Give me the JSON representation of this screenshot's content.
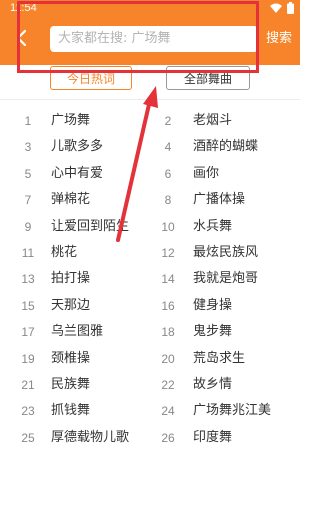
{
  "status_bar": {
    "time": "11:54"
  },
  "header": {
    "search_placeholder": "大家都在搜: 广场舞",
    "search_button": "搜索"
  },
  "tabs": [
    {
      "label": "今日热词",
      "active": true
    },
    {
      "label": "全部舞曲",
      "active": false
    }
  ],
  "list": [
    {
      "left": {
        "rank": "1",
        "name": "广场舞"
      },
      "right": {
        "rank": "2",
        "name": "老烟斗"
      }
    },
    {
      "left": {
        "rank": "3",
        "name": "儿歌多多"
      },
      "right": {
        "rank": "4",
        "name": "酒醉的蝴蝶"
      }
    },
    {
      "left": {
        "rank": "5",
        "name": "心中有爱"
      },
      "right": {
        "rank": "6",
        "name": "画你"
      }
    },
    {
      "left": {
        "rank": "7",
        "name": "弹棉花"
      },
      "right": {
        "rank": "8",
        "name": "广播体操"
      }
    },
    {
      "left": {
        "rank": "9",
        "name": "让爱回到陌生"
      },
      "right": {
        "rank": "10",
        "name": "水兵舞"
      }
    },
    {
      "left": {
        "rank": "11",
        "name": "桃花"
      },
      "right": {
        "rank": "12",
        "name": "最炫民族风"
      }
    },
    {
      "left": {
        "rank": "13",
        "name": "拍打操"
      },
      "right": {
        "rank": "14",
        "name": "我就是炮哥"
      }
    },
    {
      "left": {
        "rank": "15",
        "name": "天那边"
      },
      "right": {
        "rank": "16",
        "name": "健身操"
      }
    },
    {
      "left": {
        "rank": "17",
        "name": "乌兰图雅"
      },
      "right": {
        "rank": "18",
        "name": "鬼步舞"
      }
    },
    {
      "left": {
        "rank": "19",
        "name": "颈椎操"
      },
      "right": {
        "rank": "20",
        "name": "荒岛求生"
      }
    },
    {
      "left": {
        "rank": "21",
        "name": "民族舞"
      },
      "right": {
        "rank": "22",
        "name": "故乡情"
      }
    },
    {
      "left": {
        "rank": "23",
        "name": "抓钱舞"
      },
      "right": {
        "rank": "24",
        "name": "广场舞兆江美"
      }
    },
    {
      "left": {
        "rank": "25",
        "name": "厚德载物儿歌"
      },
      "right": {
        "rank": "26",
        "name": "印度舞"
      }
    }
  ],
  "colors": {
    "accent": "#f7842a",
    "annotation": "#e3323a"
  },
  "icons": [
    "back-arrow-icon",
    "wifi-icon",
    "battery-icon"
  ]
}
